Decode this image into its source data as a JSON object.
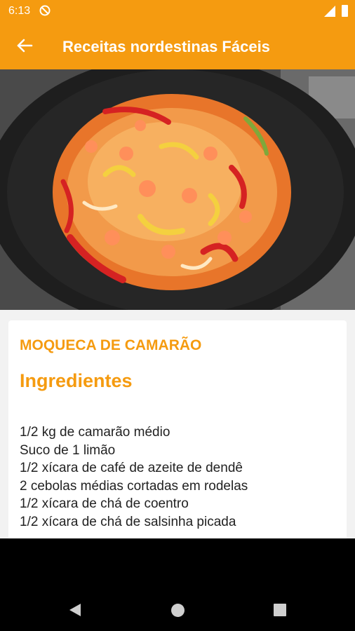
{
  "status_bar": {
    "time": "6:13",
    "icons": [
      "do-not-disturb-icon",
      "signal-icon",
      "battery-icon"
    ]
  },
  "app_bar": {
    "title": "Receitas nordestinas Fáceis",
    "back_icon": "arrow-back-icon",
    "background_color": "#F59B10"
  },
  "hero_image": {
    "subject": "moqueca-de-camarao-photo"
  },
  "recipe": {
    "title": "MOQUECA DE CAMARÃO",
    "section_title": "Ingredientes",
    "ingredients": [
      "1/2 kg de camarão médio",
      "Suco de 1 limão",
      "1/2 xícara de café de azeite de dendê",
      "2 cebolas médias cortadas em rodelas",
      "1/2 xícara de chá de coentro",
      "1/2 xícara de chá de salsinha picada"
    ],
    "accent_color": "#F59B10"
  },
  "nav_bar": {
    "icons": [
      "nav-back-icon",
      "nav-home-icon",
      "nav-recents-icon"
    ]
  }
}
